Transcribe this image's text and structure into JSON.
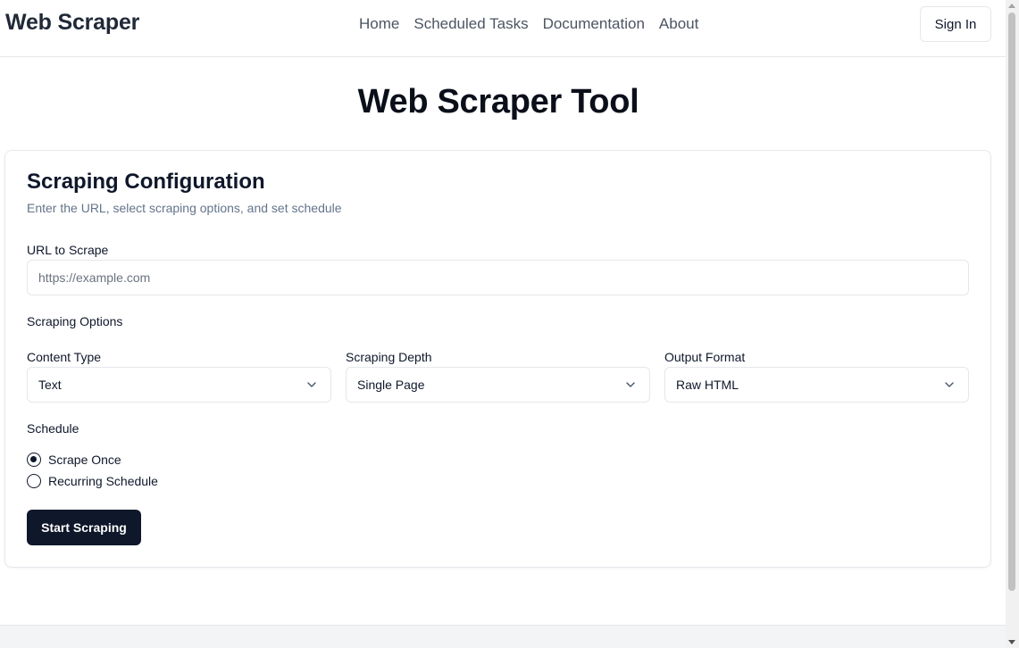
{
  "header": {
    "brand": "Web Scraper",
    "nav": [
      "Home",
      "Scheduled Tasks",
      "Documentation",
      "About"
    ],
    "sign_in_label": "Sign In"
  },
  "main": {
    "title": "Web Scraper Tool"
  },
  "card": {
    "title": "Scraping Configuration",
    "description": "Enter the URL, select scraping options, and set schedule",
    "url_label": "URL to Scrape",
    "url_placeholder": "https://example.com",
    "url_value": "",
    "options_heading": "Scraping Options",
    "content_type": {
      "label": "Content Type",
      "value": "Text"
    },
    "depth": {
      "label": "Scraping Depth",
      "value": "Single Page"
    },
    "output_format": {
      "label": "Output Format",
      "value": "Raw HTML"
    },
    "schedule_heading": "Schedule",
    "schedule_options": [
      {
        "label": "Scrape Once",
        "checked": true
      },
      {
        "label": "Recurring Schedule",
        "checked": false
      }
    ],
    "submit_label": "Start Scraping"
  },
  "icons": {
    "select_chevron": "chevron-down-icon"
  },
  "colors": {
    "primary": "#0f172a",
    "muted_text": "#64748b",
    "border": "#e5e7eb",
    "nav_text": "#4b5563"
  }
}
